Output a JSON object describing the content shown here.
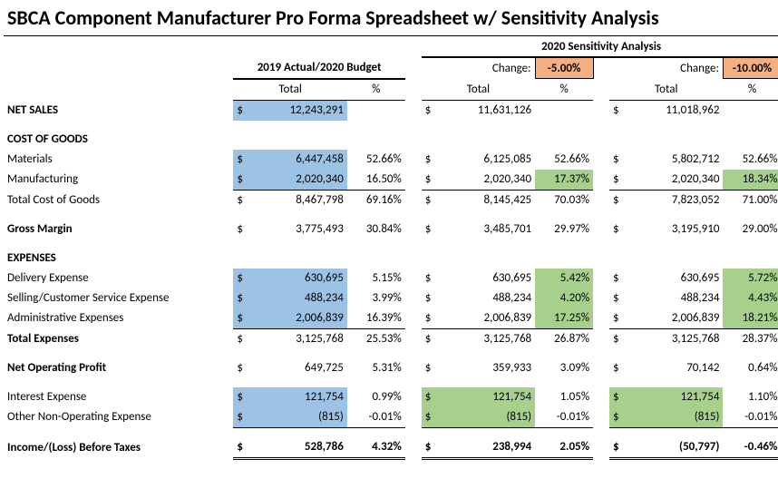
{
  "title": "SBCA Component Manufacturer Pro Forma Spreadsheet w/ Sensitivity Analysis",
  "headers": {
    "budget": "2019 Actual/2020 Budget",
    "sensitivity": "2020 Sensitivity Analysis",
    "total": "Total",
    "pct": "%",
    "change": "Change:",
    "change1": "-5.00%",
    "change2": "-10.00%"
  },
  "rows": {
    "netSales": {
      "label": "NET SALES",
      "v1": "12,243,291",
      "v2": "11,631,126",
      "v3": "11,018,962"
    },
    "cog": {
      "label": "COST OF GOODS"
    },
    "materials": {
      "label": "Materials",
      "v1": "6,447,458",
      "p1": "52.66%",
      "v2": "6,125,085",
      "p2": "52.66%",
      "v3": "5,802,712",
      "p3": "52.66%"
    },
    "manuf": {
      "label": "Manufacturing",
      "v1": "2,020,340",
      "p1": "16.50%",
      "v2": "2,020,340",
      "p2": "17.37%",
      "v3": "2,020,340",
      "p3": "18.34%"
    },
    "totalCog": {
      "label": "Total Cost of Goods",
      "v1": "8,467,798",
      "p1": "69.16%",
      "v2": "8,145,425",
      "p2": "70.03%",
      "v3": "7,823,052",
      "p3": "71.00%"
    },
    "gross": {
      "label": "Gross Margin",
      "v1": "3,775,493",
      "p1": "30.84%",
      "v2": "3,485,701",
      "p2": "29.97%",
      "v3": "3,195,910",
      "p3": "29.00%"
    },
    "exp": {
      "label": "EXPENSES"
    },
    "delivery": {
      "label": "Delivery Expense",
      "v1": "630,695",
      "p1": "5.15%",
      "v2": "630,695",
      "p2": "5.42%",
      "v3": "630,695",
      "p3": "5.72%"
    },
    "selling": {
      "label": "Selling/Customer Service Expense",
      "v1": "488,234",
      "p1": "3.99%",
      "v2": "488,234",
      "p2": "4.20%",
      "v3": "488,234",
      "p3": "4.43%"
    },
    "admin": {
      "label": "Administrative Expenses",
      "v1": "2,006,839",
      "p1": "16.39%",
      "v2": "2,006,839",
      "p2": "17.25%",
      "v3": "2,006,839",
      "p3": "18.21%"
    },
    "totalExp": {
      "label": "Total Expenses",
      "v1": "3,125,768",
      "p1": "25.53%",
      "v2": "3,125,768",
      "p2": "26.87%",
      "v3": "3,125,768",
      "p3": "28.37%"
    },
    "netOp": {
      "label": "Net Operating Profit",
      "v1": "649,725",
      "p1": "5.31%",
      "v2": "359,933",
      "p2": "3.09%",
      "v3": "70,142",
      "p3": "0.64%"
    },
    "interest": {
      "label": "Interest Expense",
      "v1": "121,754",
      "p1": "0.99%",
      "v2": "121,754",
      "p2": "1.05%",
      "v3": "121,754",
      "p3": "1.10%"
    },
    "other": {
      "label": "Other Non-Operating Expense",
      "v1": "(815)",
      "p1": "-0.01%",
      "v2": "(815)",
      "p2": "-0.01%",
      "v3": "(815)",
      "p3": "-0.01%"
    },
    "incLoss": {
      "label": "Income/(Loss) Before Taxes",
      "v1": "528,786",
      "p1": "4.32%",
      "v2": "238,994",
      "p2": "2.05%",
      "v3": "(50,797)",
      "p3": "-0.46%"
    }
  }
}
